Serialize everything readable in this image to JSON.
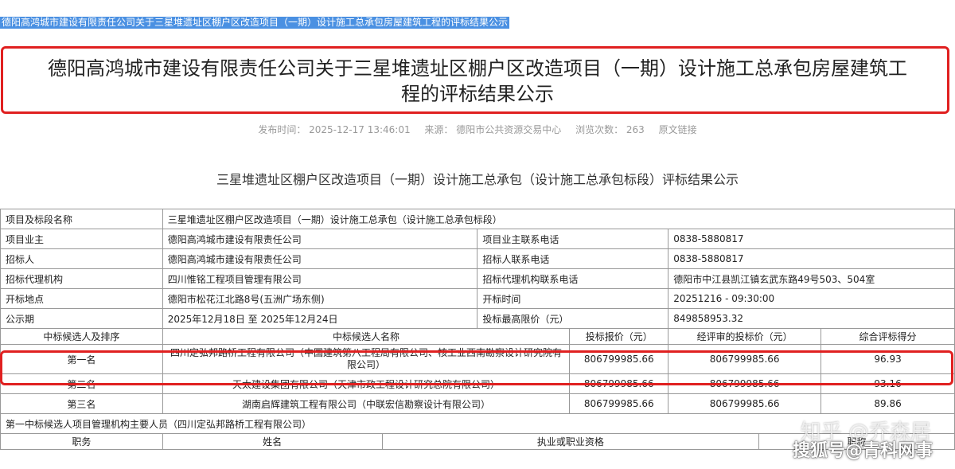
{
  "selection_text": "德阳高鸿城市建设有限责任公司关于三星堆遗址区棚户区改造项目（一期）设计施工总承包房屋建筑工程的评标结果公示",
  "title_line1": "德阳高鸿城市建设有限责任公司关于三星堆遗址区棚户区改造项目（一期）设计施工总承包房屋建筑工",
  "title_line2": "程的评标结果公示",
  "meta": {
    "publish_time": "发布时间：  2025-12-17 13:46:01",
    "source": "来源：  德阳市公共资源交易中心",
    "views": "浏览次数：  263",
    "link": "原文链接"
  },
  "subtitle": "三星堆遗址区棚户区改造项目（一期）设计施工总承包（设计施工总承包标段）评标结果公示",
  "info": {
    "project_label": "项目及标段名称",
    "project_value": "三星堆遗址区棚户区改造项目（一期）设计施工总承包（设计施工总承包标段）",
    "owner_label": "项目业主",
    "owner_value": "德阳高鸿城市建设有限责任公司",
    "owner_phone_label": "项目业主联系电话",
    "owner_phone_value": "0838-5880817",
    "tenderer_label": "招标人",
    "tenderer_value": "德阳高鸿城市建设有限责任公司",
    "tenderer_phone_label": "招标人联系电话",
    "tenderer_phone_value": "0838-5880817",
    "agency_label": "招标代理机构",
    "agency_value": "四川惟铭工程项目管理有限公司",
    "agency_phone_label": "招标代理机构联系电话",
    "agency_phone_value": "德阳市中江县凯江镇玄武东路49号503、504室",
    "open_place_label": "开标地点",
    "open_place_value": "德阳市松花江北路8号(五洲广场东侧)",
    "open_time_label": "开标时间",
    "open_time_value": "20251216 - 09:30:00",
    "period_label": "公示期",
    "period_value": "2025年12月18日 至 2025年12月24日",
    "max_price_label": "投标最高限价（元）",
    "max_price_value": "849858953.32"
  },
  "candidates_header": {
    "rank": "中标候选人及排序",
    "name": "中标候选人名称",
    "bid": "投标报价（元）",
    "reviewed": "经评审的投标价（元）",
    "score": "综合评标得分"
  },
  "candidates": [
    {
      "rank": "第一名",
      "name": "四川定弘邦路桥工程有限公司（中国建筑第八工程局有限公司、核工业西南勘察设计研究院有限公司）",
      "bid": "806799985.66",
      "reviewed": "806799985.66",
      "score": "96.93"
    },
    {
      "rank": "第二名",
      "name": "天太建设集团有限公司（天津市政工程设计研究总院有限公司）",
      "bid": "806799985.66",
      "reviewed": "806799985.66",
      "score": "93.16"
    },
    {
      "rank": "第三名",
      "name": "湖南启辉建筑工程有限公司（中联宏信勘察设计有限公司）",
      "bid": "806799985.66",
      "reviewed": "806799985.66",
      "score": "89.86"
    }
  ],
  "staff_caption": "第一中标候选人项目管理机构主要人员（四川定弘邦路桥工程有限公司）",
  "staff_header": {
    "post": "职务",
    "name": "姓名",
    "qualification": "执业或职业资格",
    "title": "职称"
  },
  "watermarks": {
    "zhihu": "知乎 @乔森居",
    "sohu": "搜狐号@青科网事"
  },
  "colors": {
    "highlight_red": "#e02020",
    "selection_blue": "#4a90e2",
    "border_grey": "#999999"
  }
}
